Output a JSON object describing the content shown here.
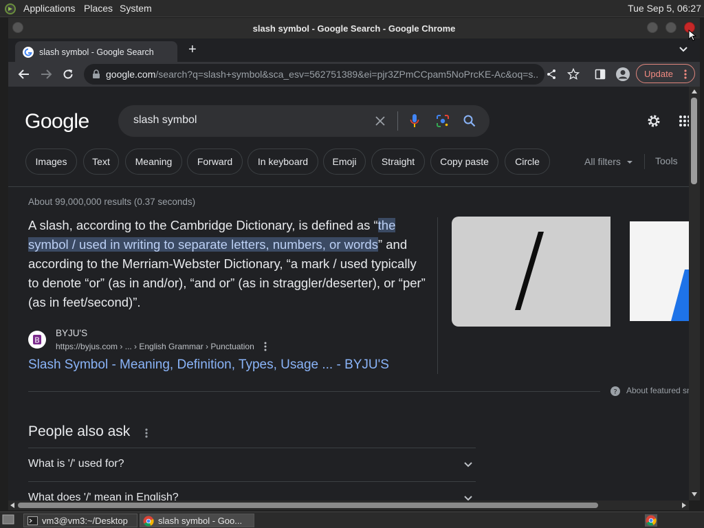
{
  "desktop": {
    "menus": [
      "Applications",
      "Places",
      "System"
    ],
    "clock": "Tue Sep  5, 06:27"
  },
  "window": {
    "title": "slash symbol - Google Search - Google Chrome"
  },
  "tab": {
    "title": "slash symbol - Google Search",
    "new_tab": "+"
  },
  "toolbar": {
    "url_host": "google.com",
    "url_path": "/search?q=slash+symbol&sca_esv=562751389&ei=pjr3ZPmCCpam5NoPrcKE-Ac&oq=s...",
    "update_label": "Update"
  },
  "search": {
    "logo": "Google",
    "query": "slash symbol",
    "chips": [
      "Images",
      "Text",
      "Meaning",
      "Forward",
      "In keyboard",
      "Emoji",
      "Straight",
      "Copy paste",
      "Circle"
    ],
    "all_filters": "All filters",
    "tools": "Tools"
  },
  "results": {
    "stats": "About 99,000,000 results (0.37 seconds)",
    "snippet_pre": "A slash, according to the Cambridge Dictionary, is defined as “",
    "snippet_hl": "the symbol / used in writing to separate letters, numbers, or words",
    "snippet_post": "” and according to the Merriam-Webster Dictionary, “a mark / used typically to denote “or” (as in and/or), “and or” (as in straggler/deserter), or “per” (as in feet/second)”.",
    "source_name": "BYJU'S",
    "source_url": "https://byjus.com › ... › English Grammar › Punctuation",
    "source_title": "Slash Symbol - Meaning, Definition, Types, Usage ... - BYJU'S",
    "about_featured": "About featured snippets",
    "image_glyph": "/"
  },
  "paa": {
    "title": "People also ask",
    "questions": [
      "What is '/' used for?",
      "What does '/' mean in English?"
    ]
  },
  "taskbar": {
    "items": [
      "vm3@vm3:~/Desktop",
      "slash symbol - Goo..."
    ]
  },
  "colors": {
    "link": "#8ab4f8",
    "highlight": "#3b4a63",
    "update": "#f28b82"
  }
}
